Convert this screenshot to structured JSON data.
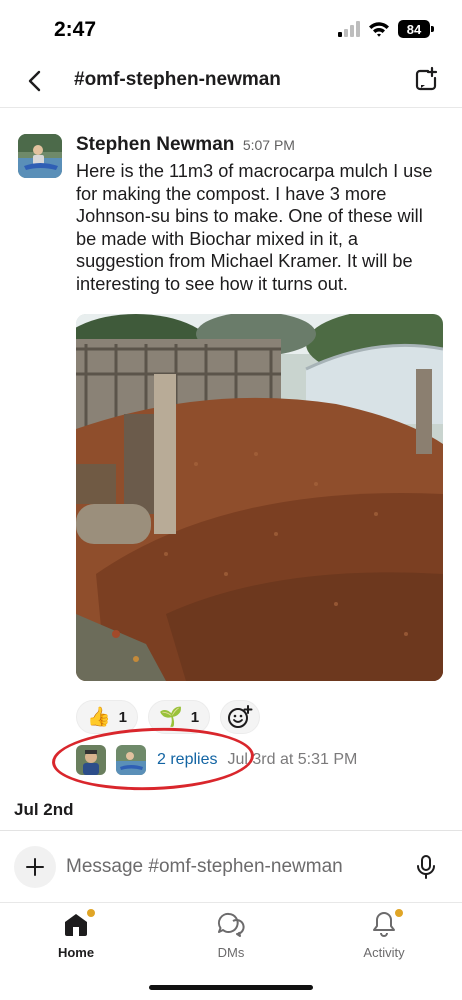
{
  "status_bar": {
    "time": "2:47",
    "battery": "84"
  },
  "header": {
    "channel": "#omf-stephen-newman"
  },
  "message": {
    "sender": "Stephen Newman",
    "time": "5:07 PM",
    "text": "Here is the 11m3 of macrocarpa mulch I use for making the compost. I have 3 more Johnson-su bins to make. One of these will be made with Biochar mixed in it, a suggestion from Michael Kramer. It will be interesting to see how it turns out.",
    "reactions": [
      {
        "emoji": "👍",
        "count": "1",
        "icon": "thumbs-up-icon"
      },
      {
        "emoji": "🌱",
        "count": "1",
        "icon": "seedling-icon"
      }
    ],
    "replies_label": "2 replies",
    "last_reply": "Jul 3rd at 5:31 PM"
  },
  "date_divider": "Jul 2nd",
  "composer": {
    "placeholder": "Message #omf-stephen-newman"
  },
  "tabs": [
    {
      "label": "Home",
      "icon": "home-icon",
      "active": true,
      "badge": true
    },
    {
      "label": "DMs",
      "icon": "dms-icon",
      "active": false,
      "badge": false
    },
    {
      "label": "Activity",
      "icon": "bell-icon",
      "active": false,
      "badge": true
    }
  ],
  "colors": {
    "link": "#1264a3",
    "badge": "#e0a526",
    "annotation": "#d9262c"
  }
}
